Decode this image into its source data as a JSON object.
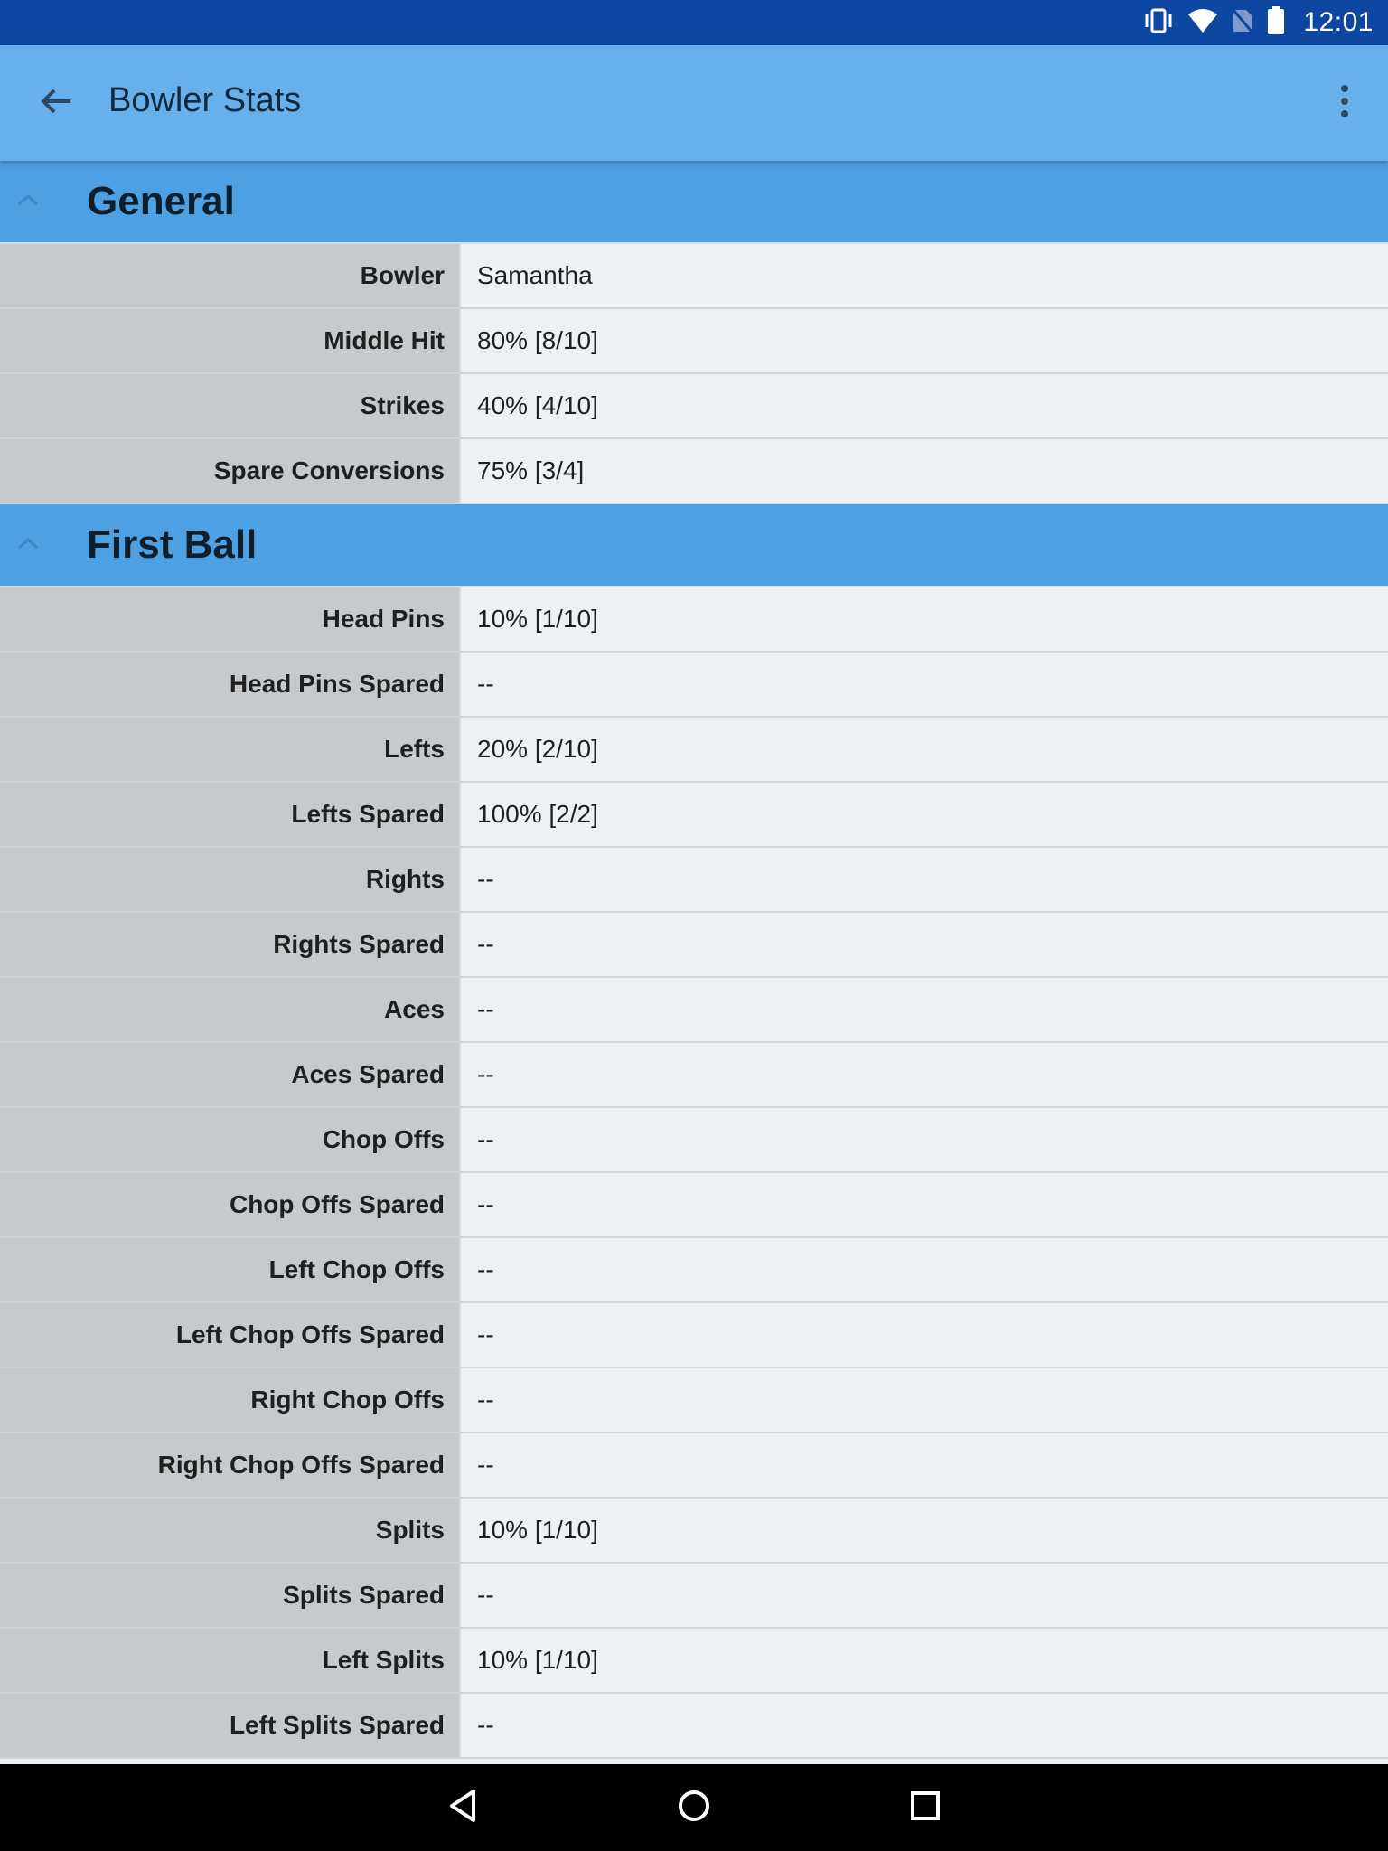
{
  "status_bar": {
    "time": "12:01"
  },
  "app_bar": {
    "title": "Bowler Stats"
  },
  "sections": [
    {
      "title": "General",
      "rows": [
        {
          "label": "Bowler",
          "value": "Samantha"
        },
        {
          "label": "Middle Hit",
          "value": "80% [8/10]"
        },
        {
          "label": "Strikes",
          "value": "40% [4/10]"
        },
        {
          "label": "Spare Conversions",
          "value": "75% [3/4]"
        }
      ]
    },
    {
      "title": "First Ball",
      "rows": [
        {
          "label": "Head Pins",
          "value": "10% [1/10]"
        },
        {
          "label": "Head Pins Spared",
          "value": "--"
        },
        {
          "label": "Lefts",
          "value": "20% [2/10]"
        },
        {
          "label": "Lefts Spared",
          "value": "100% [2/2]"
        },
        {
          "label": "Rights",
          "value": "--"
        },
        {
          "label": "Rights Spared",
          "value": "--"
        },
        {
          "label": "Aces",
          "value": "--"
        },
        {
          "label": "Aces Spared",
          "value": "--"
        },
        {
          "label": "Chop Offs",
          "value": "--"
        },
        {
          "label": "Chop Offs Spared",
          "value": "--"
        },
        {
          "label": "Left Chop Offs",
          "value": "--"
        },
        {
          "label": "Left Chop Offs Spared",
          "value": "--"
        },
        {
          "label": "Right Chop Offs",
          "value": "--"
        },
        {
          "label": "Right Chop Offs Spared",
          "value": "--"
        },
        {
          "label": "Splits",
          "value": "10% [1/10]"
        },
        {
          "label": "Splits Spared",
          "value": "--"
        },
        {
          "label": "Left Splits",
          "value": "10% [1/10]"
        },
        {
          "label": "Left Splits Spared",
          "value": "--"
        }
      ]
    }
  ]
}
